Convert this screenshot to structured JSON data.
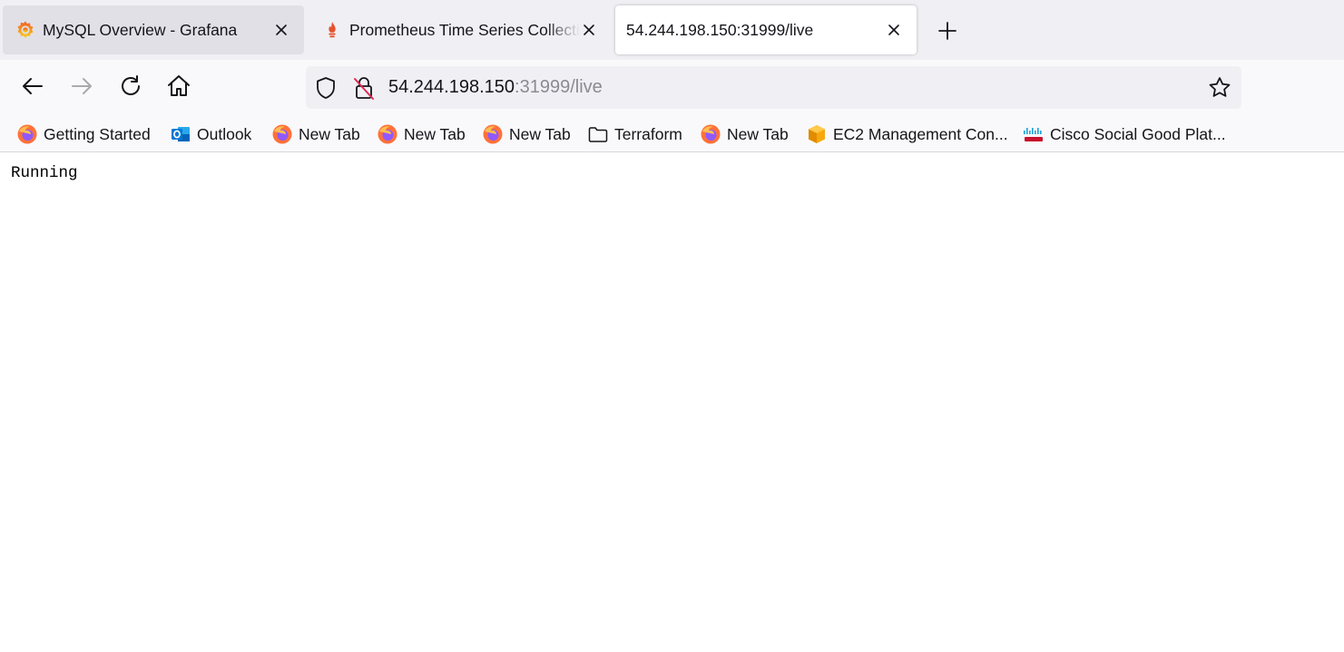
{
  "tabs": [
    {
      "title": "MySQL Overview - Grafana",
      "icon": "grafana-icon"
    },
    {
      "title": "Prometheus Time Series Collection",
      "icon": "prometheus-icon"
    },
    {
      "title": "54.244.198.150:31999/live",
      "icon": "none"
    }
  ],
  "address_bar": {
    "host": "54.244.198.150",
    "rest": ":31999/live"
  },
  "bookmarks": [
    {
      "label": "Getting Started",
      "icon": "firefox-icon"
    },
    {
      "label": "Outlook",
      "icon": "outlook-icon"
    },
    {
      "label": "New Tab",
      "icon": "firefox-icon"
    },
    {
      "label": "New Tab",
      "icon": "firefox-icon"
    },
    {
      "label": "New Tab",
      "icon": "firefox-icon"
    },
    {
      "label": "Terraform",
      "icon": "folder-icon"
    },
    {
      "label": "New Tab",
      "icon": "firefox-icon"
    },
    {
      "label": "EC2 Management Con...",
      "icon": "aws-icon"
    },
    {
      "label": "Cisco Social Good Plat...",
      "icon": "cisco-icon"
    }
  ],
  "page": {
    "body_text": "Running"
  },
  "colors": {
    "tab_strip_bg": "#f0f0f4",
    "toolbar_bg": "#f9f9fb",
    "url_host": "#15141a",
    "url_rest": "#8a8a91",
    "firefox_orange": "#ff7139",
    "firefox_purple": "#9059ff"
  }
}
